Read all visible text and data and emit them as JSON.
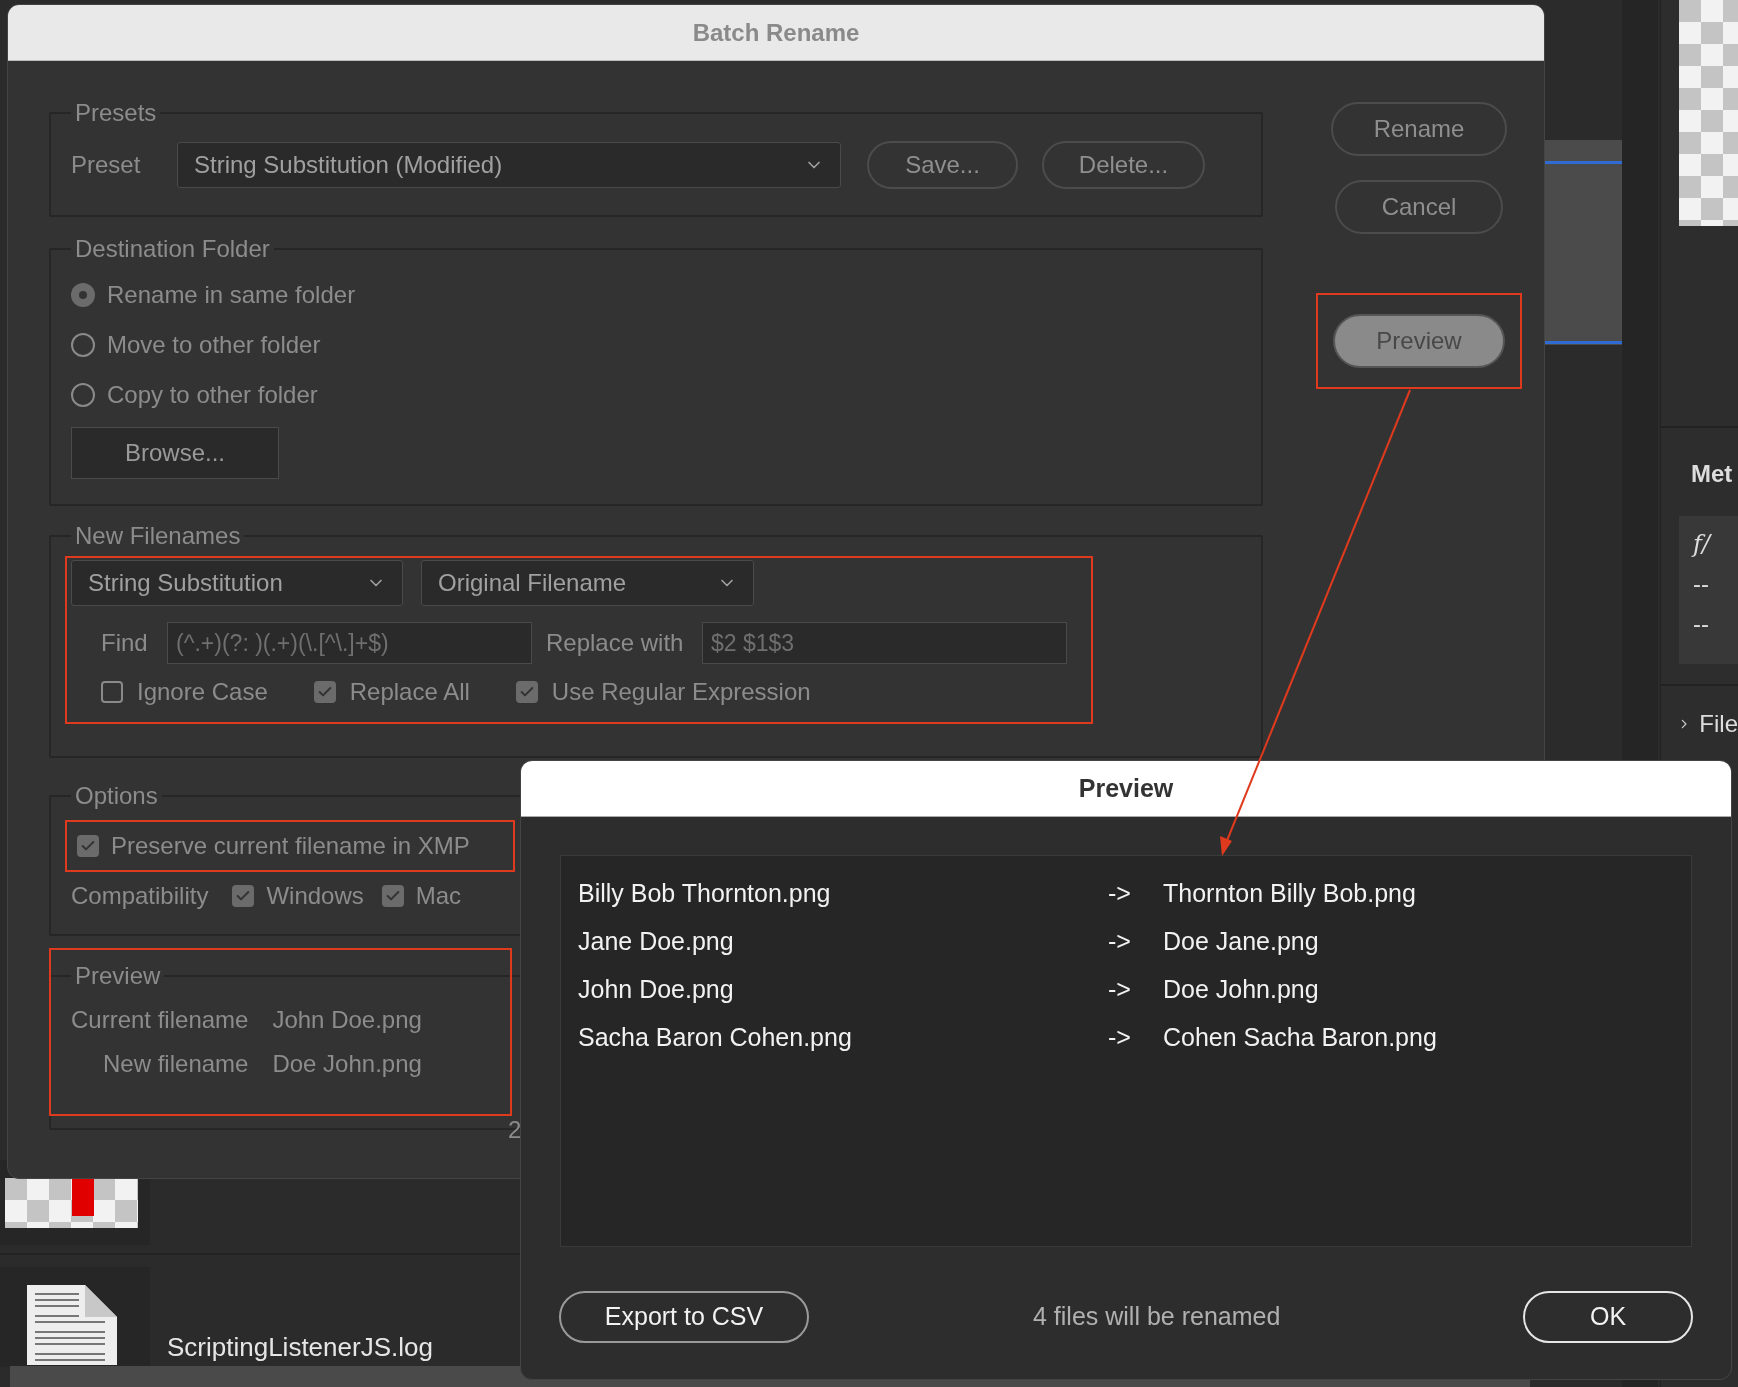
{
  "background": {
    "file_name": "ScriptingListenerJS.log",
    "side_panel": {
      "heading": "Met",
      "rows": [
        "f/",
        "--",
        "--"
      ],
      "section": "File"
    }
  },
  "dialog": {
    "title": "Batch Rename",
    "buttons": [
      {
        "label": "Rename",
        "disabled": false
      },
      {
        "label": "Cancel",
        "disabled": false
      },
      {
        "label": "Preview",
        "disabled": true
      }
    ],
    "presets": {
      "legend": "Presets",
      "label": "Preset",
      "value": "String Substitution (Modified)",
      "buttons": [
        "Save...",
        "Delete..."
      ]
    },
    "destination": {
      "legend": "Destination Folder",
      "options": [
        {
          "label": "Rename in same folder",
          "selected": true
        },
        {
          "label": "Move to other folder",
          "selected": false
        },
        {
          "label": "Copy to other folder",
          "selected": false
        }
      ],
      "browse": "Browse..."
    },
    "new_filenames": {
      "legend": "New Filenames",
      "type": "String Substitution",
      "source": "Original Filename",
      "find_label": "Find",
      "find_value": "(^.+)(?: )(.+)(\\.[^\\.]+$)",
      "replace_label": "Replace with",
      "replace_value": "$2 $1$3",
      "checks": [
        {
          "label": "Ignore Case",
          "checked": false
        },
        {
          "label": "Replace All",
          "checked": true
        },
        {
          "label": "Use Regular Expression",
          "checked": true
        }
      ]
    },
    "options": {
      "legend": "Options",
      "preserve": {
        "label": "Preserve current filename in XMP",
        "checked": true
      },
      "compat_label": "Compatibility",
      "compat": [
        {
          "label": "Windows",
          "checked": true
        },
        {
          "label": "Mac",
          "checked": true
        }
      ]
    },
    "preview": {
      "legend": "Preview",
      "rows": [
        {
          "label": "Current filename",
          "value": "John Doe.png"
        },
        {
          "label": "New filename",
          "value": "Doe John.png"
        }
      ]
    },
    "cut_text": "2"
  },
  "preview_window": {
    "title": "Preview",
    "rows": [
      {
        "from": "Billy Bob Thornton.png",
        "arrow": "->",
        "to": "Thornton Billy Bob.png"
      },
      {
        "from": "Jane Doe.png",
        "arrow": "->",
        "to": "Doe Jane.png"
      },
      {
        "from": "John Doe.png",
        "arrow": "->",
        "to": "Doe John.png"
      },
      {
        "from": "Sacha Baron Cohen.png",
        "arrow": "->",
        "to": "Cohen Sacha Baron.png"
      }
    ],
    "export": "Export to CSV",
    "summary": "4 files will be renamed",
    "ok": "OK"
  }
}
